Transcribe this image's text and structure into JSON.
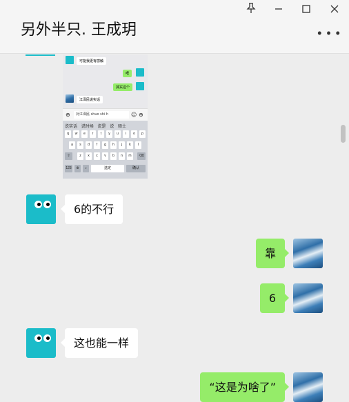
{
  "header": {
    "title": "另外半只. 王成玥"
  },
  "window": {
    "pin_icon": "pin-icon",
    "minimize_icon": "minimize-icon",
    "maximize_icon": "maximize-icon",
    "close_icon": "close-icon",
    "more_icon": "more-icon"
  },
  "embedded_screenshot": {
    "msg1": "可能我更有感触",
    "msg2": "唔",
    "msg3": "其实这个",
    "msg4": "江泽民说实话",
    "input_text": "对江泽民 shuo shi h",
    "suggestions": [
      "说实话",
      "说时候",
      "说是",
      "说",
      "硕士"
    ],
    "keys_row1": [
      "q",
      "w",
      "e",
      "r",
      "t",
      "y",
      "u",
      "i",
      "o",
      "p"
    ],
    "keys_row2": [
      "a",
      "s",
      "d",
      "f",
      "g",
      "h",
      "j",
      "k",
      "l"
    ],
    "keys_row3": [
      "z",
      "x",
      "c",
      "v",
      "b",
      "n",
      "m"
    ],
    "key_123": "123",
    "key_space": "选定",
    "key_confirm": "确认"
  },
  "messages": [
    {
      "side": "left",
      "text": "6的不行"
    },
    {
      "side": "right",
      "text": "靠"
    },
    {
      "side": "right",
      "text": "6"
    },
    {
      "side": "left",
      "text": "这也能一样"
    },
    {
      "side": "right",
      "text": "“这是为啥了”"
    }
  ],
  "colors": {
    "my_bubble": "#95ec69",
    "their_bubble": "#ffffff",
    "bot_avatar": "#1bbcc9"
  }
}
